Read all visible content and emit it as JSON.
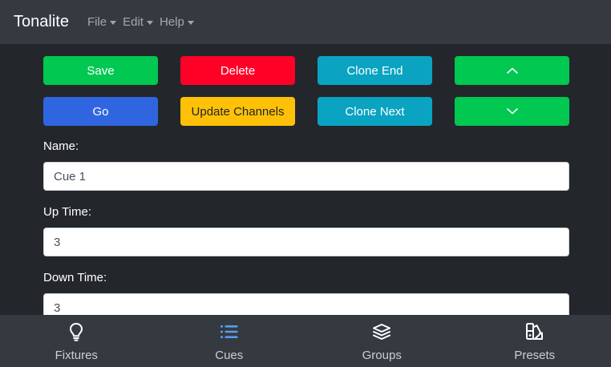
{
  "app": {
    "title": "Tonalite"
  },
  "menu": [
    {
      "label": "File"
    },
    {
      "label": "Edit"
    },
    {
      "label": "Help"
    }
  ],
  "buttons": {
    "save": "Save",
    "delete": "Delete",
    "clone_end": "Clone End",
    "go": "Go",
    "update_channels": "Update Channels",
    "clone_next": "Clone Next"
  },
  "form": {
    "name_label": "Name:",
    "name_value": "Cue 1",
    "up_time_label": "Up Time:",
    "up_time_value": "3",
    "down_time_label": "Down Time:",
    "down_time_value": "3"
  },
  "bottom_nav": [
    {
      "label": "Fixtures",
      "icon": "lightbulb-icon"
    },
    {
      "label": "Cues",
      "icon": "list-icon",
      "active": true
    },
    {
      "label": "Groups",
      "icon": "layers-icon"
    },
    {
      "label": "Presets",
      "icon": "swatchbook-icon"
    }
  ],
  "colors": {
    "background": "#23272b",
    "navbar": "#343a40",
    "green": "#00c851",
    "red": "#ff0026",
    "cyan": "#0aa3c2",
    "blue": "#2f66e0",
    "yellow": "#ffc107",
    "active_tab": "#5b9bf0"
  }
}
